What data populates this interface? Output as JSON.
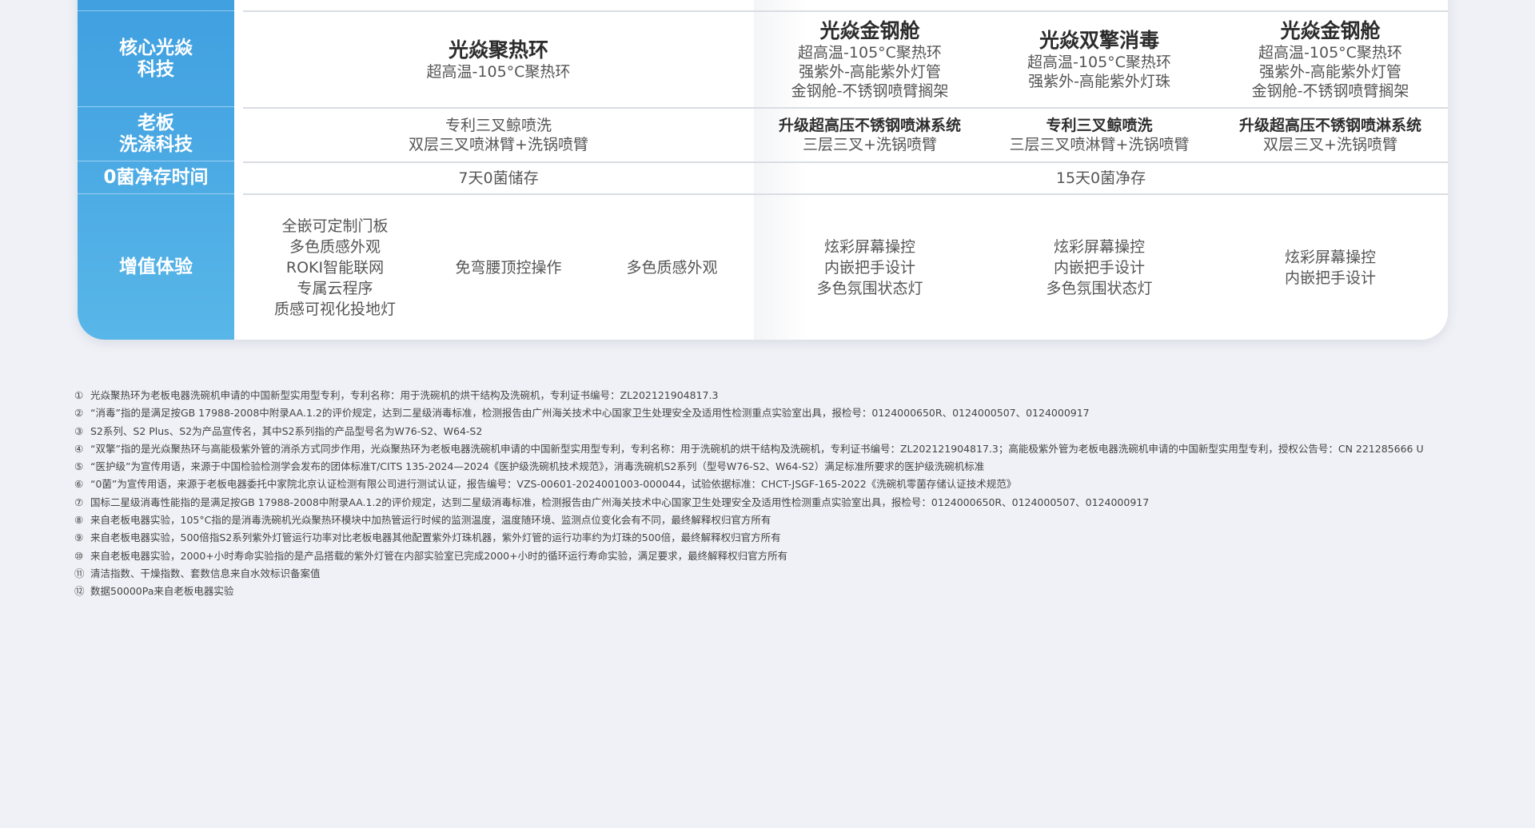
{
  "rows": {
    "core": "核心光焱科技",
    "core_lines": [
      "核心光焱",
      "科技"
    ],
    "wash_lines": [
      "老板",
      "洗涤科技"
    ],
    "zero": "0菌净存时间",
    "value": "增值体验"
  },
  "core_cells": [
    {
      "title": "光焱聚热环",
      "lines": [
        "超高温-105°C聚热环"
      ]
    },
    {
      "title": "光焱金钢舱",
      "lines": [
        "超高温-105°C聚热环",
        "强紫外-高能紫外灯管",
        "金钢舱-不锈钢喷臂搁架"
      ]
    },
    {
      "title": "光焱双擎消毒",
      "lines": [
        "超高温-105°C聚热环",
        "强紫外-高能紫外灯珠"
      ]
    },
    {
      "title": "光焱金钢舱",
      "lines": [
        "超高温-105°C聚热环",
        "强紫外-高能紫外灯管",
        "金钢舱-不锈钢喷臂搁架"
      ]
    }
  ],
  "wash_cells": [
    {
      "title": "专利三叉鲸喷洗",
      "lines": [
        "双层三叉喷淋臂+洗锅喷臂"
      ],
      "bold": false
    },
    {
      "title": "升级超高压不锈钢喷淋系统",
      "lines": [
        "三层三叉+洗锅喷臂"
      ],
      "bold": true
    },
    {
      "title": "专利三叉鲸喷洗",
      "lines": [
        "三层三叉喷淋臂+洗锅喷臂"
      ],
      "bold": true
    },
    {
      "title": "升级超高压不锈钢喷淋系统",
      "lines": [
        "双层三叉+洗锅喷臂"
      ],
      "bold": true
    }
  ],
  "zero_cells": [
    "7天0菌储存",
    "15天0菌净存"
  ],
  "value_cells": [
    [
      "全嵌可定制门板",
      "多色质感外观",
      "ROKI智能联网",
      "专属云程序",
      "质感可视化投地灯"
    ],
    [
      "免弯腰顶控操作"
    ],
    [
      "多色质感外观"
    ],
    [
      "炫彩屏幕操控",
      "内嵌把手设计",
      "多色氛围状态灯"
    ],
    [
      "炫彩屏幕操控",
      "内嵌把手设计",
      "多色氛围状态灯"
    ],
    [
      "炫彩屏幕操控",
      "内嵌把手设计"
    ]
  ],
  "notes": [
    {
      "n": "①",
      "text": "光焱聚热环为老板电器洗碗机申请的中国新型实用型专利，专利名称：用于洗碗机的烘干结构及洗碗机，专利证书编号：ZL202121904817.3"
    },
    {
      "n": "②",
      "text": "“消毒”指的是满足按GB 17988-2008中附录AA.1.2的评价规定，达到二星级消毒标准，检测报告由广州海关技术中心国家卫生处理安全及适用性检测重点实验室出具，报检号：0124000650R、0124000507、0124000917"
    },
    {
      "n": "③",
      "text": "S2系列、S2 Plus、S2为产品宣传名，其中S2系列指的产品型号名为W76-S2、W64-S2"
    },
    {
      "n": "④",
      "text": "“双擎”指的是光焱聚热环与高能极紫外管的消杀方式同步作用，光焱聚热环为老板电器洗碗机申请的中国新型实用型专利，专利名称：用于洗碗机的烘干结构及洗碗机，专利证书编号：ZL202121904817.3；高能极紫外管为老板电器洗碗机申请的中国新型实用型专利，授权公告号：CN 221285666 U"
    },
    {
      "n": "⑤",
      "text": "“医护级”为宣传用语，来源于中国检验检测学会发布的团体标准T/CITS 135-2024—2024《医护级洗碗机技术规范》，消毒洗碗机S2系列（型号W76-S2、W64-S2）满足标准所要求的医护级洗碗机标准"
    },
    {
      "n": "⑥",
      "text": "“0菌”为宣传用语，来源于老板电器委托中家院北京认证检测有限公司进行测试认证，报告编号：VZS-00601-2024001003-000044，试验依据标准：CHCT-JSGF-165-2022《洗碗机零菌存储认证技术规范》"
    },
    {
      "n": "⑦",
      "text": "国标二星级消毒性能指的是满足按GB 17988-2008中附录AA.1.2的评价规定，达到二星级消毒标准，检测报告由广州海关技术中心国家卫生处理安全及适用性检测重点实验室出具，报检号：0124000650R、0124000507、0124000917"
    },
    {
      "n": "⑧",
      "text": "来自老板电器实验，105°C指的是消毒洗碗机光焱聚热环模块中加热管运行时候的监测温度，温度随环境、监测点位变化会有不同，最终解释权归官方所有"
    },
    {
      "n": "⑨",
      "text": "来自老板电器实验，500倍指S2系列紫外灯管运行功率对比老板电器其他配置紫外灯珠机器，紫外灯管的运行功率约为灯珠的500倍，最终解释权归官方所有"
    },
    {
      "n": "⑩",
      "text": "来自老板电器实验，2000+小时寿命实验指的是产品搭载的紫外灯管在内部实验室已完成2000+小时的循环运行寿命实验，满足要求，最终解释权归官方所有"
    },
    {
      "n": "⑪",
      "text": "清洁指数、干燥指数、套数信息来自水效标识备案值"
    },
    {
      "n": "⑫",
      "text": "数据50000Pa来自老板电器实验"
    }
  ]
}
